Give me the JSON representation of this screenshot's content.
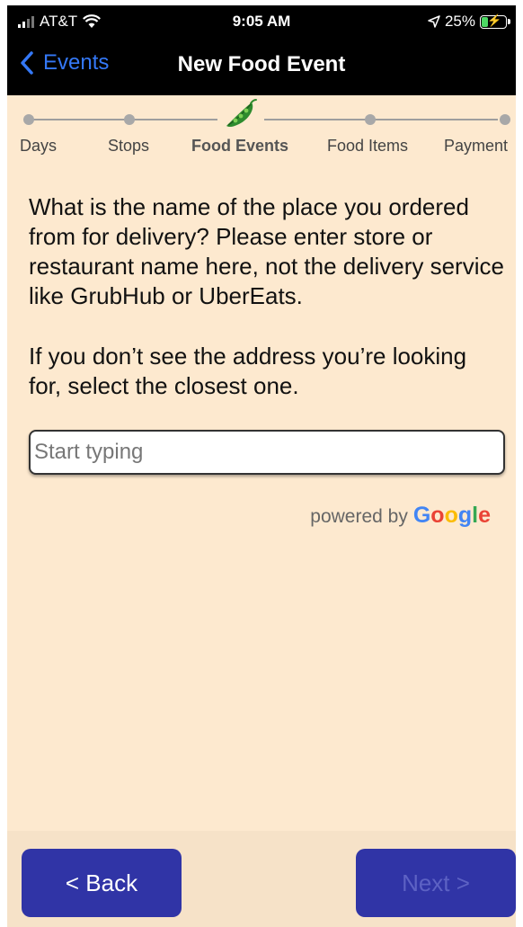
{
  "status_bar": {
    "carrier": "AT&T",
    "time": "9:05 AM",
    "battery": "25%"
  },
  "nav": {
    "back_label": "Events",
    "title": "New Food Event"
  },
  "stepper": {
    "steps": [
      "Days",
      "Stops",
      "Food Events",
      "Food Items",
      "Payment"
    ],
    "active_step": "Food Events"
  },
  "prompt": {
    "question": "What is the name of the place you ordered from for delivery? Please enter store or restaurant name here, not the delivery service like GrubHub or UberEats.",
    "hint": "If you don’t see the address you’re looking for, select the closest one."
  },
  "search": {
    "placeholder": "Start typing",
    "value": ""
  },
  "attribution": {
    "prefix": "powered by",
    "brand_letters": [
      "G",
      "o",
      "o",
      "g",
      "l",
      "e"
    ]
  },
  "footer": {
    "back_label": "< Back",
    "next_label": "Next >",
    "next_enabled": false
  },
  "colors": {
    "background": "#fde9cf",
    "nav_accent": "#3478f6",
    "button": "#3034a6",
    "google": [
      "#4285f4",
      "#ea4335",
      "#fbbc05",
      "#4285f4",
      "#34a853",
      "#ea4335"
    ]
  }
}
